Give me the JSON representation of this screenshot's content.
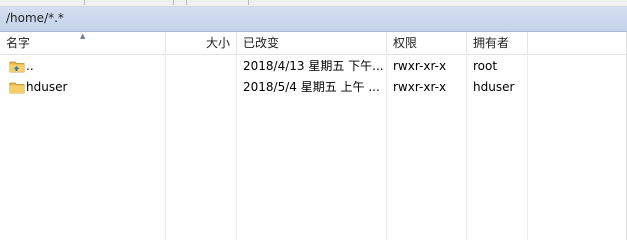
{
  "path": "/home/*.*",
  "columns": {
    "name": "名字",
    "size": "大小",
    "modified": "已改变",
    "permissions": "权限",
    "owner": "拥有者"
  },
  "rows": [
    {
      "name": "..",
      "size": "",
      "modified": "2018/4/13 星期五 下午...",
      "permissions": "rwxr-xr-x",
      "owner": "root",
      "icon": "parent-folder-icon"
    },
    {
      "name": "hduser",
      "size": "",
      "modified": "2018/5/4 星期五 上午 ...",
      "permissions": "rwxr-xr-x",
      "owner": "hduser",
      "icon": "folder-icon"
    }
  ],
  "colors": {
    "path_bar": "#c9d6ee",
    "folder": "#e8b84a"
  }
}
